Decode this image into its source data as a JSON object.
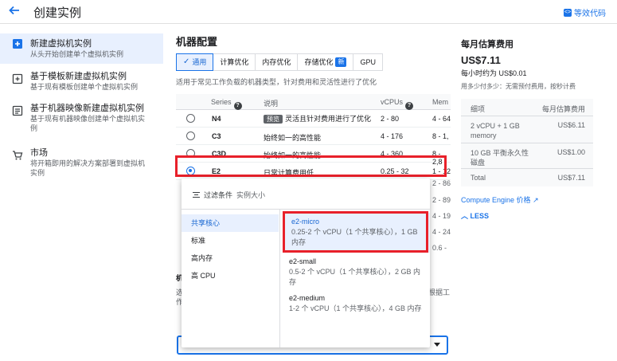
{
  "header": {
    "title": "创建实例",
    "equivalent_code": "等效代码"
  },
  "sidebar": {
    "items": [
      {
        "title": "新建虚拟机实例",
        "desc": "从头开始创建单个虚拟机实例"
      },
      {
        "title": "基于模板新建虚拟机实例",
        "desc": "基于现有模板创建单个虚拟机实例"
      },
      {
        "title": "基于机器映像新建虚拟机实例",
        "desc": "基于现有机器映像创建单个虚拟机实例"
      },
      {
        "title": "市场",
        "desc": "将开箱即用的解决方案部署到虚拟机实例"
      }
    ]
  },
  "machine": {
    "title": "机器配置",
    "tabs": [
      "通用",
      "计算优化",
      "内存优化",
      "存储优化",
      "GPU"
    ],
    "new_badge": "新",
    "description": "适用于常见工作负载的机器类型，针对费用和灵活性进行了优化",
    "table": {
      "headers": [
        "Series",
        "说明",
        "vCPUs",
        "Mem"
      ],
      "rows": [
        {
          "series": "N4",
          "desc": "灵活且针对费用进行了优化",
          "vcpus": "2 - 80",
          "mem": "4 - 64"
        },
        {
          "series": "C3",
          "desc": "始终如一的高性能",
          "vcpus": "4 - 176",
          "mem": "8 - 1,"
        },
        {
          "series": "C3D",
          "desc": "始终如一的高性能",
          "vcpus": "4 - 360",
          "mem": "8 - 2,8"
        },
        {
          "series": "E2",
          "desc": "日常计算费用低",
          "vcpus": "0.25 - 32",
          "mem": "1 - 12"
        }
      ],
      "preview_badge": "预览",
      "extra_mem": [
        "2 - 86",
        "2 - 89",
        "4 - 19",
        "4 - 24",
        "0.6 - "
      ]
    },
    "partial_texts": {
      "m": "机",
      "s1": "选",
      "s2": "作",
      "right_text": "根据工"
    }
  },
  "dropdown": {
    "filter_label": "过滤条件",
    "filter_placeholder": "实例大小",
    "categories": [
      "共享核心",
      "标准",
      "高内存",
      "高 CPU"
    ],
    "options": [
      {
        "name": "e2-micro",
        "desc": "0.25-2 个 vCPU（1 个共享核心），1 GB 内存"
      },
      {
        "name": "e2-small",
        "desc": "0.5-2 个 vCPU（1 个共享核心），2 GB 内存"
      },
      {
        "name": "e2-medium",
        "desc": "1-2 个 vCPU（1 个共享核心），4 GB 内存"
      }
    ]
  },
  "cost": {
    "title": "每月估算费用",
    "price": "US$7.11",
    "hourly": "每小时约为 US$0.01",
    "note": "用多少付多少：无需预付费用，按秒计费",
    "headers": [
      "细项",
      "每月估算费用"
    ],
    "rows": [
      {
        "item": "2 vCPU + 1 GB memory",
        "cost": "US$6.11"
      },
      {
        "item": "10 GB 平衡永久性磁盘",
        "cost": "US$1.00"
      }
    ],
    "total_label": "Total",
    "total_value": "US$7.11",
    "pricing_link": "Compute Engine 价格",
    "less_label": "LESS"
  }
}
